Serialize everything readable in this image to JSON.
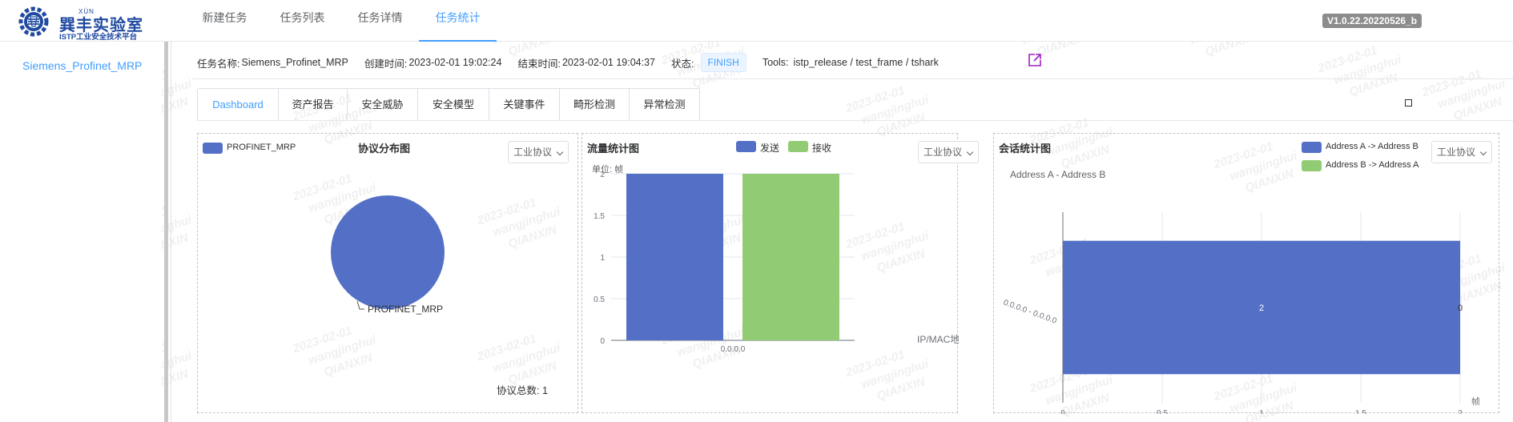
{
  "header": {
    "logo": {
      "pinyin": "XÙN",
      "name": "巽丰实验室",
      "subtitle": "ISTP工业安全技术平台"
    },
    "nav": [
      {
        "label": "新建任务",
        "active": false
      },
      {
        "label": "任务列表",
        "active": false
      },
      {
        "label": "任务详情",
        "active": false
      },
      {
        "label": "任务统计",
        "active": true
      }
    ],
    "version": "V1.0.22.20220526_b"
  },
  "sidebar": {
    "items": [
      {
        "label": "Siemens_Profinet_MRP"
      }
    ]
  },
  "task_info": {
    "name_label": "任务名称:",
    "name": "Siemens_Profinet_MRP",
    "created_label": "创建时间:",
    "created": "2023-02-01 19:02:24",
    "ended_label": "结束时间:",
    "ended": "2023-02-01 19:04:37",
    "status_label": "状态:",
    "status": "FINISH",
    "tools_label": "Tools:",
    "tools": "istp_release / test_frame / tshark"
  },
  "tabs": [
    {
      "label": "Dashboard",
      "active": true
    },
    {
      "label": "资产报告",
      "active": false
    },
    {
      "label": "安全威胁",
      "active": false
    },
    {
      "label": "安全模型",
      "active": false
    },
    {
      "label": "关键事件",
      "active": false
    },
    {
      "label": "畸形检测",
      "active": false
    },
    {
      "label": "异常检测",
      "active": false
    }
  ],
  "colors": {
    "accent": "#409eff",
    "series_blue": "#5470c6",
    "series_green": "#91cc75",
    "version_badge": "#8c8c8c",
    "brand": "#1f4aa0"
  },
  "panels": {
    "protocol": {
      "title": "协议分布图",
      "select": "工业协议",
      "legend": "PROFINET_MRP",
      "total_label": "协议总数:",
      "total": "1"
    },
    "traffic": {
      "title": "流量统计图",
      "select": "工业协议",
      "unit": "单位: 帧",
      "x_axis_name": "IP/MAC地址"
    },
    "session": {
      "title": "会话统计图",
      "select": "工业协议",
      "subtitle": "Address A - Address B",
      "x_axis_name": "帧"
    }
  },
  "watermark": {
    "lines": [
      "2023-02-01",
      "wangjinghui",
      "QIANXIN"
    ]
  },
  "chart_data": [
    {
      "type": "pie",
      "title": "协议分布图",
      "slices": [
        {
          "name": "PROFINET_MRP",
          "value": 1
        }
      ],
      "legend": [
        "PROFINET_MRP"
      ],
      "legend_position": "top-left"
    },
    {
      "type": "bar",
      "title": "流量统计图",
      "categories": [
        "0.0.0.0"
      ],
      "series": [
        {
          "name": "发送",
          "values": [
            2
          ]
        },
        {
          "name": "接收",
          "values": [
            2
          ]
        }
      ],
      "ylabel": "单位: 帧",
      "xlabel": "IP/MAC地址",
      "ylim": [
        0,
        2
      ],
      "yticks": [
        "0",
        "0.5",
        "1",
        "1.5",
        "2"
      ],
      "grid": true,
      "legend_position": "top"
    },
    {
      "type": "bar",
      "orientation": "horizontal",
      "title": "会话统计图",
      "subtitle": "Address A - Address B",
      "categories": [
        "0.0.0.0 - 0.0.0.0"
      ],
      "series": [
        {
          "name": "Address A -> Address B",
          "values": [
            2
          ]
        },
        {
          "name": "Address B -> Address A",
          "values": [
            0
          ]
        }
      ],
      "xlabel": "帧",
      "xlim": [
        0,
        2
      ],
      "xticks": [
        "0",
        "0.5",
        "1",
        "1.5",
        "2"
      ],
      "grid": true,
      "legend_position": "top-right"
    }
  ]
}
